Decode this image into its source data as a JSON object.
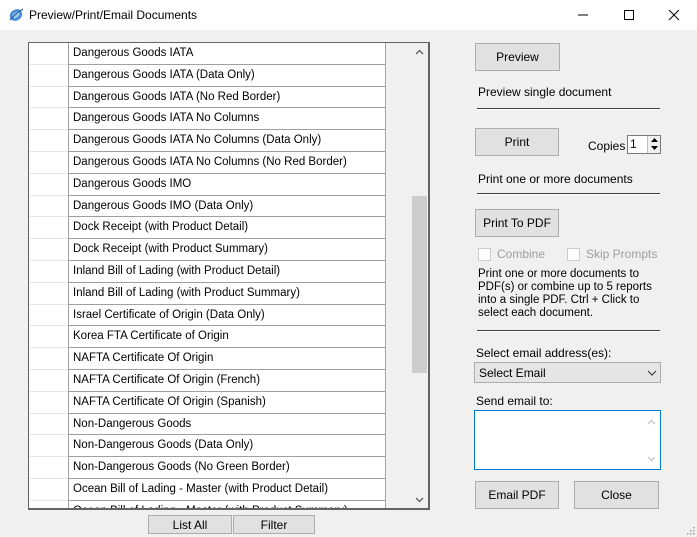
{
  "window": {
    "title": "Preview/Print/Email Documents",
    "icon": "globe-app-icon",
    "controls": {
      "minimize": "minimize-icon",
      "maximize": "maximize-icon",
      "close": "close-icon"
    }
  },
  "document_list": {
    "rows": [
      "Dangerous Goods IATA",
      "Dangerous Goods IATA (Data Only)",
      "Dangerous Goods IATA (No Red Border)",
      "Dangerous Goods IATA No Columns",
      "Dangerous Goods IATA No Columns (Data Only)",
      "Dangerous Goods IATA No Columns (No Red Border)",
      "Dangerous Goods IMO",
      "Dangerous Goods IMO (Data Only)",
      "Dock Receipt (with Product Detail)",
      "Dock Receipt (with Product Summary)",
      "Inland Bill of Lading (with Product Detail)",
      "Inland Bill of Lading (with Product Summary)",
      "Israel Certificate of Origin (Data Only)",
      "Korea FTA Certificate of Origin",
      "NAFTA Certificate Of Origin",
      "NAFTA Certificate Of Origin (French)",
      "NAFTA Certificate Of Origin (Spanish)",
      "Non-Dangerous Goods",
      "Non-Dangerous Goods (Data Only)",
      "Non-Dangerous Goods (No Green Border)",
      "Ocean Bill of Lading - Master (with Product Detail)",
      "Ocean Bill of Lading - Master (with Product Summary)"
    ],
    "list_all_label": "List All",
    "filter_label": "Filter"
  },
  "preview": {
    "button_label": "Preview",
    "description": "Preview single document"
  },
  "print": {
    "button_label": "Print",
    "copies_label": "Copies",
    "copies_value": "1",
    "description": "Print one or more documents"
  },
  "pdf": {
    "button_label": "Print To PDF",
    "combine_label": "Combine",
    "skip_prompts_label": "Skip Prompts",
    "description": "Print one or more documents to PDF(s) or combine up to 5 reports into a single PDF.  Ctrl + Click to select each document."
  },
  "email": {
    "select_label": "Select email address(es):",
    "select_value": "Select Email",
    "send_to_label": "Send email to:",
    "send_to_value": "",
    "email_pdf_label": "Email PDF",
    "close_label": "Close"
  }
}
